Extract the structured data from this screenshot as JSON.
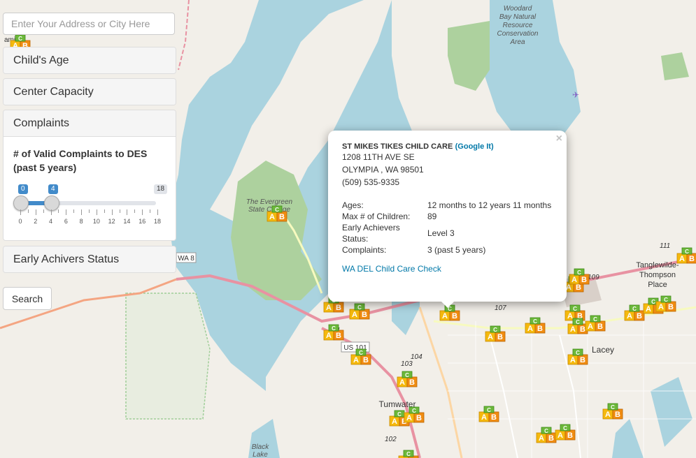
{
  "search": {
    "placeholder": "Enter Your Address or City Here"
  },
  "filters": {
    "age_label": "Child's Age",
    "capacity_label": "Center Capacity",
    "complaints_label": "Complaints",
    "achievers_label": "Early Achivers Status",
    "complaints_slider": {
      "title": "# of Valid Complaints to DES (past 5 years)",
      "min_selected": "0",
      "max_selected": "4",
      "max": "18",
      "ticks": [
        "0",
        "2",
        "4",
        "6",
        "8",
        "10",
        "12",
        "14",
        "16",
        "18"
      ]
    }
  },
  "search_button": "Search",
  "popup": {
    "name": "ST MIKES TIKES CHILD CARE",
    "google_link": "(Google It)",
    "street": "1208 11TH AVE SE",
    "city": "OLYMPIA , WA 98501",
    "phone": "(509) 535-9335",
    "rows": [
      {
        "k": "Ages:",
        "v": "12 months to 12 years 11 months"
      },
      {
        "k": "Max # of Children:",
        "v": "89"
      },
      {
        "k": "Early Achievers Status:",
        "v": "Level 3"
      },
      {
        "k": "Complaints:",
        "v": "3 (past 5 years)"
      }
    ],
    "del_link": "WA DEL Child Care Check",
    "close_icon": "×"
  },
  "map_labels": {
    "woodard": [
      "Woodard",
      "Bay Natural",
      "Resource",
      "Conservation",
      "Area"
    ],
    "evergreen": [
      "The Evergreen",
      "State College"
    ],
    "tanglewilde": [
      "Tanglewilde-",
      "Thompson",
      "Place"
    ],
    "lacey": "Lacey",
    "tumwater": "Tumwater",
    "black_lake": [
      "Black",
      "Lake"
    ],
    "wa8": "WA 8",
    "us101": "US 101",
    "r101": "101",
    "r107": "107",
    "r103": "103",
    "r104": "104",
    "r102": "102",
    "r109": "109",
    "r111": "111",
    "kamil": "amil"
  },
  "colors": {
    "water": "#aad3df",
    "land": "#f2efe9",
    "forest": "#add19e",
    "highway": "#e892a2",
    "primary_road": "#fcd6a4",
    "accent": "#428bca"
  }
}
